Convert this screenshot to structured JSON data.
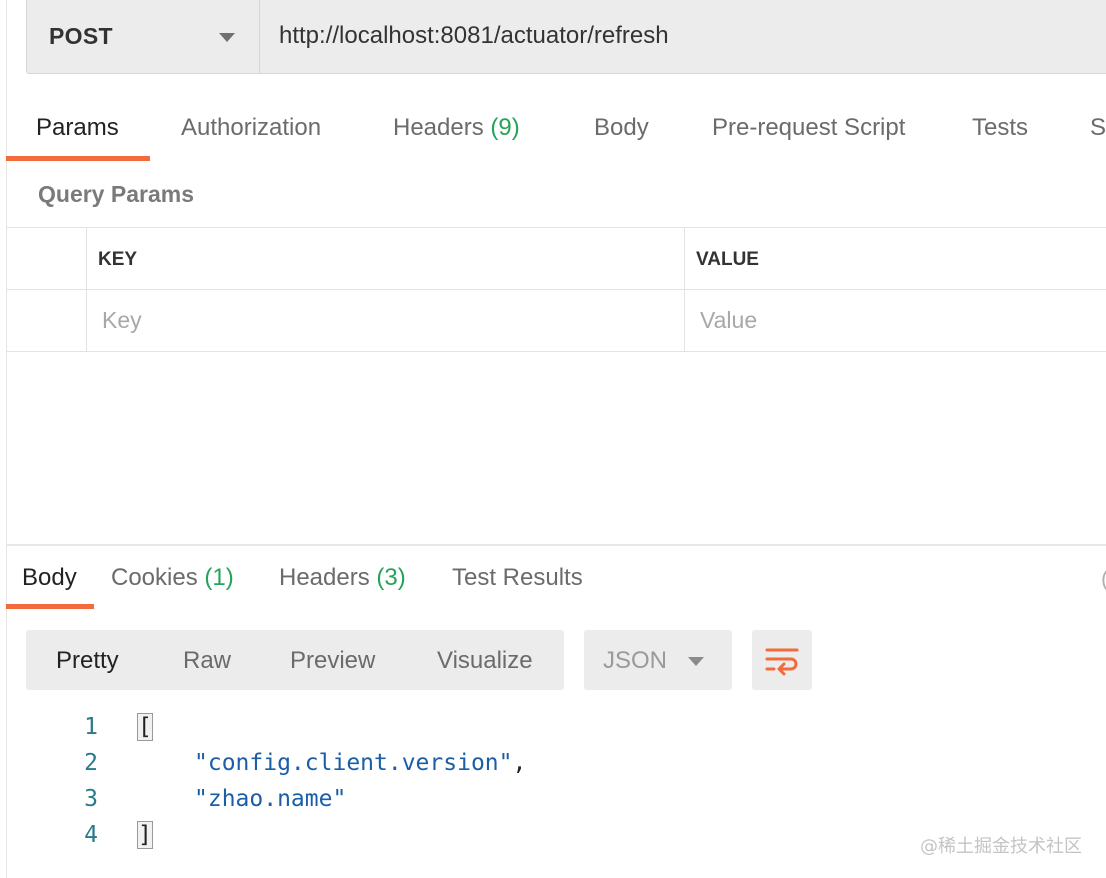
{
  "request": {
    "method": "POST",
    "url": "http://localhost:8081/actuator/refresh"
  },
  "request_tabs": [
    {
      "label": "Params",
      "count": ""
    },
    {
      "label": "Authorization",
      "count": ""
    },
    {
      "label": "Headers",
      "count": "(9)"
    },
    {
      "label": "Body",
      "count": ""
    },
    {
      "label": "Pre-request Script",
      "count": ""
    },
    {
      "label": "Tests",
      "count": ""
    },
    {
      "label": "Se",
      "count": ""
    }
  ],
  "query_params": {
    "title": "Query Params",
    "columns": [
      "KEY",
      "VALUE"
    ],
    "key_placeholder": "Key",
    "value_placeholder": "Value"
  },
  "response_tabs": [
    {
      "label": "Body",
      "count": ""
    },
    {
      "label": "Cookies",
      "count": "(1)"
    },
    {
      "label": "Headers",
      "count": "(3)"
    },
    {
      "label": "Test Results",
      "count": ""
    }
  ],
  "response_view": {
    "modes": [
      "Pretty",
      "Raw",
      "Preview",
      "Visualize"
    ],
    "format": "JSON",
    "wrap_icon": "wrap-lines-icon"
  },
  "response_body": {
    "lines": [
      {
        "number": "1",
        "text": "["
      },
      {
        "number": "2",
        "text": "\"config.client.version\","
      },
      {
        "number": "3",
        "text": "\"zhao.name\""
      },
      {
        "number": "4",
        "text": "]"
      }
    ]
  },
  "watermark": "@稀土掘金技术社区",
  "colors": {
    "accent": "#f26b3a",
    "count": "#26a35a",
    "string": "#1a5ea8",
    "line_number": "#2a7a8a"
  }
}
